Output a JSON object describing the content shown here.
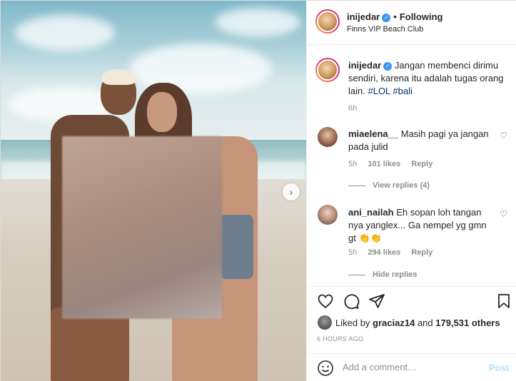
{
  "post": {
    "photo": {
      "next_icon": "chevron-right-icon"
    },
    "header": {
      "username": "inijedar",
      "verified_icon": "verified-badge-icon",
      "separator": "•",
      "follow_status": "Following",
      "location": "Finns VIP Beach Club"
    },
    "caption": {
      "username": "inijedar",
      "text": "Jangan membenci dirimu sendiri, karena itu adalah tugas orang lain.",
      "hashtags": [
        "#LOL",
        "#bali"
      ],
      "time": "6h"
    },
    "comments": [
      {
        "username": "miaelena__",
        "text": "Masih pagi ya jangan pada julid",
        "time": "5h",
        "likes": "101 likes",
        "reply_label": "Reply",
        "replies_label": "View replies (4)"
      },
      {
        "username": "ani_nailah",
        "text": "Eh sopan loh tangan nya yanglex... Ga nempel yg gmn gt",
        "emoji": "👏👏",
        "time": "5h",
        "likes": "294 likes",
        "reply_label": "Reply",
        "replies_label": "Hide replies"
      }
    ],
    "actions": {
      "like_icon": "heart-icon",
      "comment_icon": "comment-icon",
      "share_icon": "share-icon",
      "save_icon": "bookmark-icon"
    },
    "likes": {
      "prefix": "Liked by",
      "user": "graciaz14",
      "and": "and",
      "count": "179,531 others"
    },
    "timestamp": "6 HOURS AGO",
    "add_comment": {
      "emoji_icon": "smiley-icon",
      "placeholder": "Add a comment…",
      "post_label": "Post"
    }
  }
}
